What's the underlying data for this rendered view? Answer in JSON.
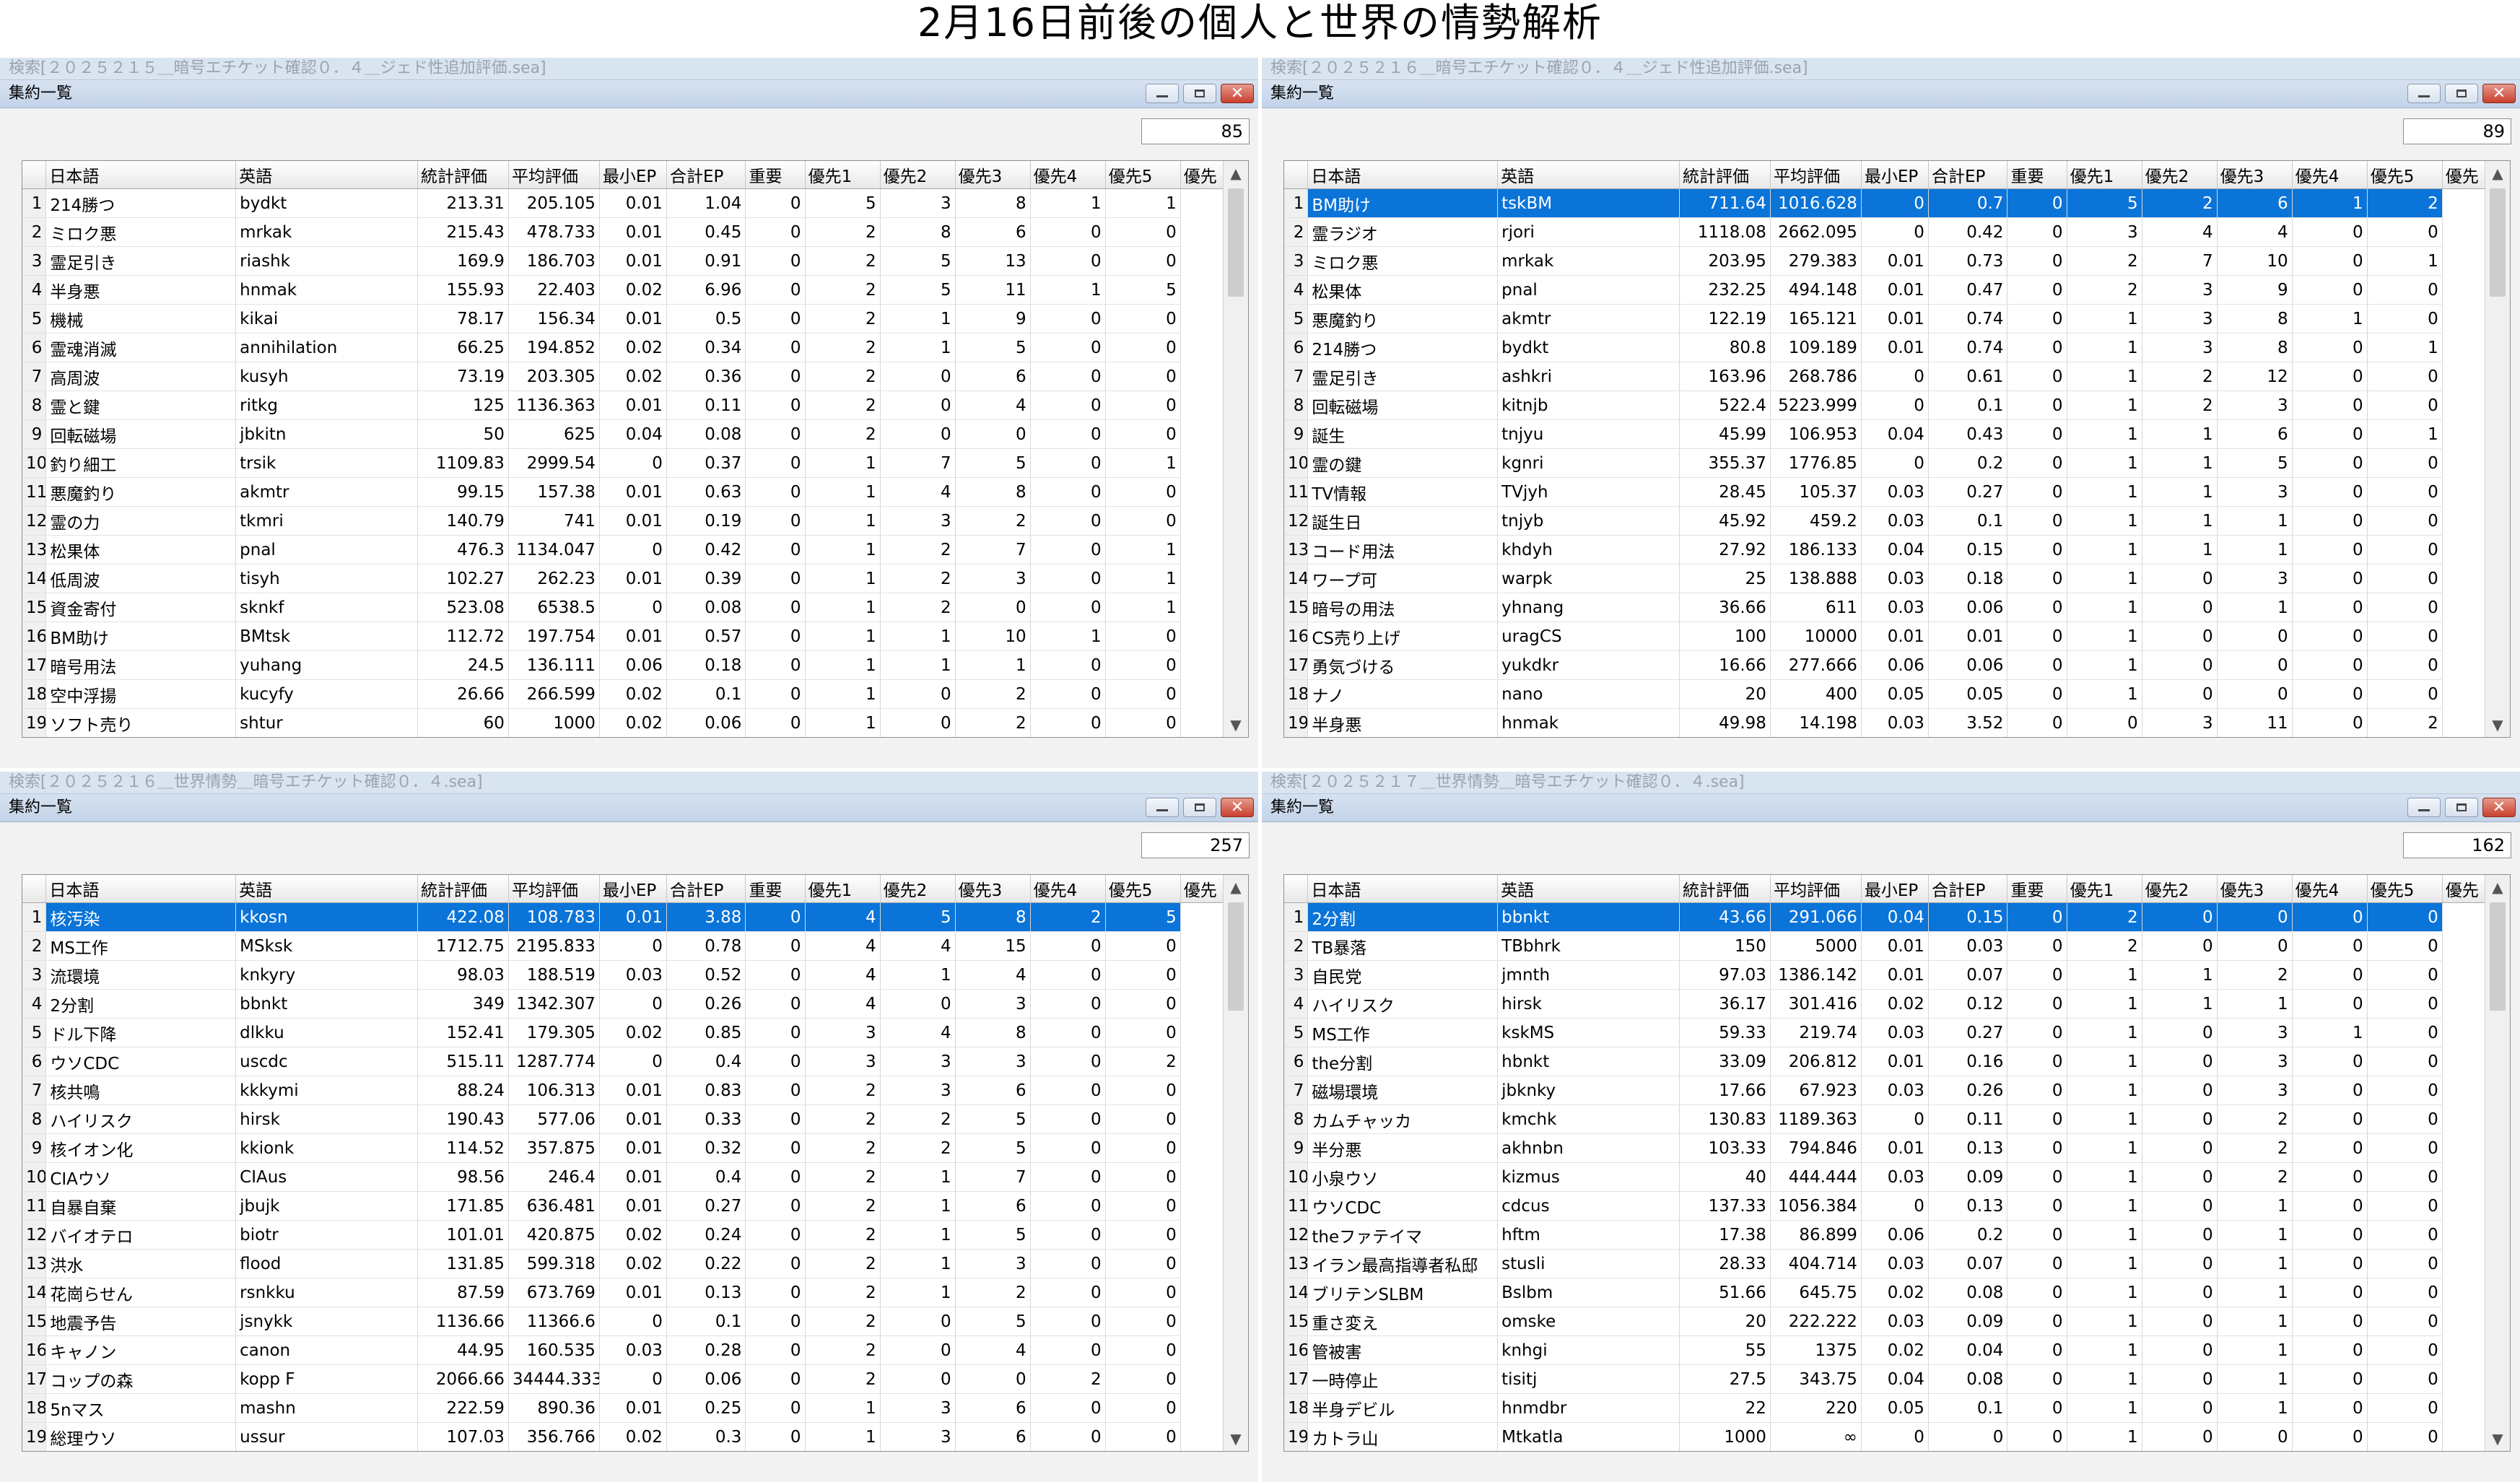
{
  "page_title": "2月16日前後の個人と世界の情勢解析",
  "columns": [
    "日本語",
    "英語",
    "統計評価",
    "平均評価",
    "最小EP",
    "合計EP",
    "重要",
    "優先1",
    "優先2",
    "優先3",
    "優先4",
    "優先5",
    "優先"
  ],
  "panels": [
    {
      "file": "検索[２０２５２１５＿暗号エチケット確認０．４＿ジェド性追加評価.sea]",
      "window_title": "集約一覧",
      "count": "85",
      "selected_row": -1,
      "rows": [
        [
          "1",
          "214勝つ",
          "bydkt",
          "213.31",
          "205.105",
          "0.01",
          "1.04",
          "0",
          "5",
          "3",
          "8",
          "1",
          "1"
        ],
        [
          "2",
          "ミロク悪",
          "mrkak",
          "215.43",
          "478.733",
          "0.01",
          "0.45",
          "0",
          "2",
          "8",
          "6",
          "0",
          "0"
        ],
        [
          "3",
          "霊足引き",
          "riashk",
          "169.9",
          "186.703",
          "0.01",
          "0.91",
          "0",
          "2",
          "5",
          "13",
          "0",
          "0"
        ],
        [
          "4",
          "半身悪",
          "hnmak",
          "155.93",
          "22.403",
          "0.02",
          "6.96",
          "0",
          "2",
          "5",
          "11",
          "1",
          "5"
        ],
        [
          "5",
          "機械",
          "kikai",
          "78.17",
          "156.34",
          "0.01",
          "0.5",
          "0",
          "2",
          "1",
          "9",
          "0",
          "0"
        ],
        [
          "6",
          "霊魂消滅",
          "annihilation",
          "66.25",
          "194.852",
          "0.02",
          "0.34",
          "0",
          "2",
          "1",
          "5",
          "0",
          "0"
        ],
        [
          "7",
          "高周波",
          "kusyh",
          "73.19",
          "203.305",
          "0.02",
          "0.36",
          "0",
          "2",
          "0",
          "6",
          "0",
          "0"
        ],
        [
          "8",
          "霊と鍵",
          "ritkg",
          "125",
          "1136.363",
          "0.01",
          "0.11",
          "0",
          "2",
          "0",
          "4",
          "0",
          "0"
        ],
        [
          "9",
          "回転磁場",
          "jbkitn",
          "50",
          "625",
          "0.04",
          "0.08",
          "0",
          "2",
          "0",
          "0",
          "0",
          "0"
        ],
        [
          "10",
          "釣り細工",
          "trsik",
          "1109.83",
          "2999.54",
          "0",
          "0.37",
          "0",
          "1",
          "7",
          "5",
          "0",
          "1"
        ],
        [
          "11",
          "悪魔釣り",
          "akmtr",
          "99.15",
          "157.38",
          "0.01",
          "0.63",
          "0",
          "1",
          "4",
          "8",
          "0",
          "0"
        ],
        [
          "12",
          "霊の力",
          "tkmri",
          "140.79",
          "741",
          "0.01",
          "0.19",
          "0",
          "1",
          "3",
          "2",
          "0",
          "0"
        ],
        [
          "13",
          "松果体",
          "pnal",
          "476.3",
          "1134.047",
          "0",
          "0.42",
          "0",
          "1",
          "2",
          "7",
          "0",
          "1"
        ],
        [
          "14",
          "低周波",
          "tisyh",
          "102.27",
          "262.23",
          "0.01",
          "0.39",
          "0",
          "1",
          "2",
          "3",
          "0",
          "1"
        ],
        [
          "15",
          "資金寄付",
          "sknkf",
          "523.08",
          "6538.5",
          "0",
          "0.08",
          "0",
          "1",
          "2",
          "0",
          "0",
          "1"
        ],
        [
          "16",
          "BM助け",
          "BMtsk",
          "112.72",
          "197.754",
          "0.01",
          "0.57",
          "0",
          "1",
          "1",
          "10",
          "1",
          "0"
        ],
        [
          "17",
          "暗号用法",
          "yuhang",
          "24.5",
          "136.111",
          "0.06",
          "0.18",
          "0",
          "1",
          "1",
          "1",
          "0",
          "0"
        ],
        [
          "18",
          "空中浮揚",
          "kucyfy",
          "26.66",
          "266.599",
          "0.02",
          "0.1",
          "0",
          "1",
          "0",
          "2",
          "0",
          "0"
        ],
        [
          "19",
          "ソフト売り",
          "shtur",
          "60",
          "1000",
          "0.02",
          "0.06",
          "0",
          "1",
          "0",
          "2",
          "0",
          "0"
        ]
      ]
    },
    {
      "file": "検索[２０２５２１６＿暗号エチケット確認０．４＿ジェド性追加評価.sea]",
      "window_title": "集約一覧",
      "count": "89",
      "selected_row": 0,
      "rows": [
        [
          "1",
          "BM助け",
          "tskBM",
          "711.64",
          "1016.628",
          "0",
          "0.7",
          "0",
          "5",
          "2",
          "6",
          "1",
          "2"
        ],
        [
          "2",
          "霊ラジオ",
          "rjori",
          "1118.08",
          "2662.095",
          "0",
          "0.42",
          "0",
          "3",
          "4",
          "4",
          "0",
          "0"
        ],
        [
          "3",
          "ミロク悪",
          "mrkak",
          "203.95",
          "279.383",
          "0.01",
          "0.73",
          "0",
          "2",
          "7",
          "10",
          "0",
          "1"
        ],
        [
          "4",
          "松果体",
          "pnal",
          "232.25",
          "494.148",
          "0.01",
          "0.47",
          "0",
          "2",
          "3",
          "9",
          "0",
          "0"
        ],
        [
          "5",
          "悪魔釣り",
          "akmtr",
          "122.19",
          "165.121",
          "0.01",
          "0.74",
          "0",
          "1",
          "3",
          "8",
          "1",
          "0"
        ],
        [
          "6",
          "214勝つ",
          "bydkt",
          "80.8",
          "109.189",
          "0.01",
          "0.74",
          "0",
          "1",
          "3",
          "8",
          "0",
          "1"
        ],
        [
          "7",
          "霊足引き",
          "ashkri",
          "163.96",
          "268.786",
          "0",
          "0.61",
          "0",
          "1",
          "2",
          "12",
          "0",
          "0"
        ],
        [
          "8",
          "回転磁場",
          "kitnjb",
          "522.4",
          "5223.999",
          "0",
          "0.1",
          "0",
          "1",
          "2",
          "3",
          "0",
          "0"
        ],
        [
          "9",
          "誕生",
          "tnjyu",
          "45.99",
          "106.953",
          "0.04",
          "0.43",
          "0",
          "1",
          "1",
          "6",
          "0",
          "1"
        ],
        [
          "10",
          "霊の鍵",
          "kgnri",
          "355.37",
          "1776.85",
          "0",
          "0.2",
          "0",
          "1",
          "1",
          "5",
          "0",
          "0"
        ],
        [
          "11",
          "TV情報",
          "TVjyh",
          "28.45",
          "105.37",
          "0.03",
          "0.27",
          "0",
          "1",
          "1",
          "3",
          "0",
          "0"
        ],
        [
          "12",
          "誕生日",
          "tnjyb",
          "45.92",
          "459.2",
          "0.03",
          "0.1",
          "0",
          "1",
          "1",
          "1",
          "0",
          "0"
        ],
        [
          "13",
          "コード用法",
          "khdyh",
          "27.92",
          "186.133",
          "0.04",
          "0.15",
          "0",
          "1",
          "1",
          "1",
          "0",
          "0"
        ],
        [
          "14",
          "ワープ可",
          "warpk",
          "25",
          "138.888",
          "0.03",
          "0.18",
          "0",
          "1",
          "0",
          "3",
          "0",
          "0"
        ],
        [
          "15",
          "暗号の用法",
          "yhnang",
          "36.66",
          "611",
          "0.03",
          "0.06",
          "0",
          "1",
          "0",
          "1",
          "0",
          "0"
        ],
        [
          "16",
          "CS売り上げ",
          "uragCS",
          "100",
          "10000",
          "0.01",
          "0.01",
          "0",
          "1",
          "0",
          "0",
          "0",
          "0"
        ],
        [
          "17",
          "勇気づける",
          "yukdkr",
          "16.66",
          "277.666",
          "0.06",
          "0.06",
          "0",
          "1",
          "0",
          "0",
          "0",
          "0"
        ],
        [
          "18",
          "ナノ",
          "nano",
          "20",
          "400",
          "0.05",
          "0.05",
          "0",
          "1",
          "0",
          "0",
          "0",
          "0"
        ],
        [
          "19",
          "半身悪",
          "hnmak",
          "49.98",
          "14.198",
          "0.03",
          "3.52",
          "0",
          "0",
          "3",
          "11",
          "0",
          "2"
        ]
      ]
    },
    {
      "file": "検索[２０２５２１６＿世界情勢＿暗号エチケット確認０．４.sea]",
      "window_title": "集約一覧",
      "count": "257",
      "selected_row": 0,
      "rows": [
        [
          "1",
          "核汚染",
          "kkosn",
          "422.08",
          "108.783",
          "0.01",
          "3.88",
          "0",
          "4",
          "5",
          "8",
          "2",
          "5"
        ],
        [
          "2",
          "MS工作",
          "MSksk",
          "1712.75",
          "2195.833",
          "0",
          "0.78",
          "0",
          "4",
          "4",
          "15",
          "0",
          "0"
        ],
        [
          "3",
          "流環境",
          "knkyry",
          "98.03",
          "188.519",
          "0.03",
          "0.52",
          "0",
          "4",
          "1",
          "4",
          "0",
          "0"
        ],
        [
          "4",
          "2分割",
          "bbnkt",
          "349",
          "1342.307",
          "0",
          "0.26",
          "0",
          "4",
          "0",
          "3",
          "0",
          "0"
        ],
        [
          "5",
          "ドル下降",
          "dlkku",
          "152.41",
          "179.305",
          "0.02",
          "0.85",
          "0",
          "3",
          "4",
          "8",
          "0",
          "0"
        ],
        [
          "6",
          "ウソCDC",
          "uscdc",
          "515.11",
          "1287.774",
          "0",
          "0.4",
          "0",
          "3",
          "3",
          "3",
          "0",
          "2"
        ],
        [
          "7",
          "核共鳴",
          "kkkymi",
          "88.24",
          "106.313",
          "0.01",
          "0.83",
          "0",
          "2",
          "3",
          "6",
          "0",
          "0"
        ],
        [
          "8",
          "ハイリスク",
          "hirsk",
          "190.43",
          "577.06",
          "0.01",
          "0.33",
          "0",
          "2",
          "2",
          "5",
          "0",
          "0"
        ],
        [
          "9",
          "核イオン化",
          "kkionk",
          "114.52",
          "357.875",
          "0.01",
          "0.32",
          "0",
          "2",
          "2",
          "5",
          "0",
          "0"
        ],
        [
          "10",
          "CIAウソ",
          "CIAus",
          "98.56",
          "246.4",
          "0.01",
          "0.4",
          "0",
          "2",
          "1",
          "7",
          "0",
          "0"
        ],
        [
          "11",
          "自暴自棄",
          "jbujk",
          "171.85",
          "636.481",
          "0.01",
          "0.27",
          "0",
          "2",
          "1",
          "6",
          "0",
          "0"
        ],
        [
          "12",
          "バイオテロ",
          "biotr",
          "101.01",
          "420.875",
          "0.02",
          "0.24",
          "0",
          "2",
          "1",
          "5",
          "0",
          "0"
        ],
        [
          "13",
          "洪水",
          "flood",
          "131.85",
          "599.318",
          "0.02",
          "0.22",
          "0",
          "2",
          "1",
          "3",
          "0",
          "0"
        ],
        [
          "14",
          "花崗らせん",
          "rsnkku",
          "87.59",
          "673.769",
          "0.01",
          "0.13",
          "0",
          "2",
          "1",
          "2",
          "0",
          "0"
        ],
        [
          "15",
          "地震予告",
          "jsnykk",
          "1136.66",
          "11366.6",
          "0",
          "0.1",
          "0",
          "2",
          "0",
          "5",
          "0",
          "0"
        ],
        [
          "16",
          "キャノン",
          "canon",
          "44.95",
          "160.535",
          "0.03",
          "0.28",
          "0",
          "2",
          "0",
          "4",
          "0",
          "0"
        ],
        [
          "17",
          "コップの森",
          "kopp F",
          "2066.66",
          "34444.333",
          "0",
          "0.06",
          "0",
          "2",
          "0",
          "0",
          "2",
          "0"
        ],
        [
          "18",
          "5nマス",
          "mashn",
          "222.59",
          "890.36",
          "0.01",
          "0.25",
          "0",
          "1",
          "3",
          "6",
          "0",
          "0"
        ],
        [
          "19",
          "総理ウソ",
          "ussur",
          "107.03",
          "356.766",
          "0.02",
          "0.3",
          "0",
          "1",
          "3",
          "6",
          "0",
          "0"
        ]
      ]
    },
    {
      "file": "検索[２０２５２１７＿世界情勢＿暗号エチケット確認０．４.sea]",
      "window_title": "集約一覧",
      "count": "162",
      "selected_row": 0,
      "rows": [
        [
          "1",
          "2分割",
          "bbnkt",
          "43.66",
          "291.066",
          "0.04",
          "0.15",
          "0",
          "2",
          "0",
          "0",
          "0",
          "0"
        ],
        [
          "2",
          "TB暴落",
          "TBbhrk",
          "150",
          "5000",
          "0.01",
          "0.03",
          "0",
          "2",
          "0",
          "0",
          "0",
          "0"
        ],
        [
          "3",
          "自民党",
          "jmnth",
          "97.03",
          "1386.142",
          "0.01",
          "0.07",
          "0",
          "1",
          "1",
          "2",
          "0",
          "0"
        ],
        [
          "4",
          "ハイリスク",
          "hirsk",
          "36.17",
          "301.416",
          "0.02",
          "0.12",
          "0",
          "1",
          "1",
          "1",
          "0",
          "0"
        ],
        [
          "5",
          "MS工作",
          "kskMS",
          "59.33",
          "219.74",
          "0.03",
          "0.27",
          "0",
          "1",
          "0",
          "3",
          "1",
          "0"
        ],
        [
          "6",
          "the分割",
          "hbnkt",
          "33.09",
          "206.812",
          "0.01",
          "0.16",
          "0",
          "1",
          "0",
          "3",
          "0",
          "0"
        ],
        [
          "7",
          "磁場環境",
          "jbknky",
          "17.66",
          "67.923",
          "0.03",
          "0.26",
          "0",
          "1",
          "0",
          "3",
          "0",
          "0"
        ],
        [
          "8",
          "カムチャッカ",
          "kmchk",
          "130.83",
          "1189.363",
          "0",
          "0.11",
          "0",
          "1",
          "0",
          "2",
          "0",
          "0"
        ],
        [
          "9",
          "半分悪",
          "akhnbn",
          "103.33",
          "794.846",
          "0.01",
          "0.13",
          "0",
          "1",
          "0",
          "2",
          "0",
          "0"
        ],
        [
          "10",
          "小泉ウソ",
          "kizmus",
          "40",
          "444.444",
          "0.03",
          "0.09",
          "0",
          "1",
          "0",
          "2",
          "0",
          "0"
        ],
        [
          "11",
          "ウソCDC",
          "cdcus",
          "137.33",
          "1056.384",
          "0",
          "0.13",
          "0",
          "1",
          "0",
          "1",
          "0",
          "0"
        ],
        [
          "12",
          "theファテイマ",
          "hftm",
          "17.38",
          "86.899",
          "0.06",
          "0.2",
          "0",
          "1",
          "0",
          "1",
          "0",
          "0"
        ],
        [
          "13",
          "イラン最高指導者私邸",
          "stusli",
          "28.33",
          "404.714",
          "0.03",
          "0.07",
          "0",
          "1",
          "0",
          "1",
          "0",
          "0"
        ],
        [
          "14",
          "ブリテンSLBM",
          "Bslbm",
          "51.66",
          "645.75",
          "0.02",
          "0.08",
          "0",
          "1",
          "0",
          "1",
          "0",
          "0"
        ],
        [
          "15",
          "重さ変え",
          "omske",
          "20",
          "222.222",
          "0.03",
          "0.09",
          "0",
          "1",
          "0",
          "1",
          "0",
          "0"
        ],
        [
          "16",
          "管被害",
          "knhgi",
          "55",
          "1375",
          "0.02",
          "0.04",
          "0",
          "1",
          "0",
          "1",
          "0",
          "0"
        ],
        [
          "17",
          "一時停止",
          "tisitj",
          "27.5",
          "343.75",
          "0.04",
          "0.08",
          "0",
          "1",
          "0",
          "1",
          "0",
          "0"
        ],
        [
          "18",
          "半身デビル",
          "hnmdbr",
          "22",
          "220",
          "0.05",
          "0.1",
          "0",
          "1",
          "0",
          "1",
          "0",
          "0"
        ],
        [
          "19",
          "カトラ山",
          "Mtkatla",
          "1000",
          "∞",
          "0",
          "0",
          "0",
          "1",
          "0",
          "0",
          "0",
          "0"
        ]
      ]
    }
  ]
}
